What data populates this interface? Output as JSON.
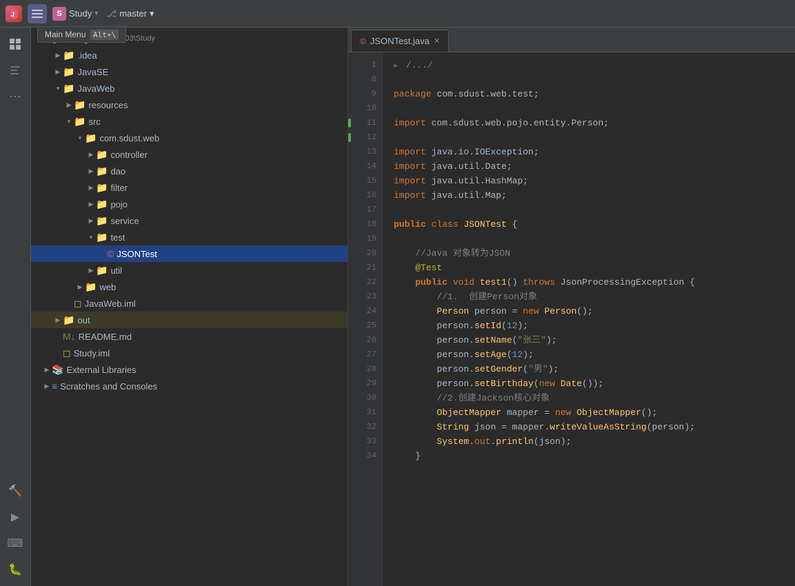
{
  "titlebar": {
    "app_icon": "J",
    "menu_icon": "☰",
    "project_name": "Study",
    "project_chevron": "▾",
    "branch_icon": "⎇",
    "branch_name": "master",
    "branch_chevron": "▾"
  },
  "tooltip": {
    "label": "Main Menu",
    "shortcut": "Alt+\\"
  },
  "iconbar": {
    "icons": [
      {
        "name": "folder-icon",
        "glyph": "📁"
      },
      {
        "name": "structure-icon",
        "glyph": "⊞"
      },
      {
        "name": "more-icon",
        "glyph": "⋯"
      }
    ],
    "bottom_icons": [
      {
        "name": "hammer-icon",
        "glyph": "🔨"
      },
      {
        "name": "run-icon",
        "glyph": "▶"
      },
      {
        "name": "terminal-icon",
        "glyph": "⌨"
      },
      {
        "name": "debug-icon",
        "glyph": "🐛"
      }
    ]
  },
  "filetree": {
    "items": [
      {
        "id": "study-root",
        "label": "Study",
        "path": "E:\\java2403\\Study",
        "indent": "indent1",
        "arrow": "▾",
        "expanded": true,
        "icon": "📁",
        "icon_class": "folder-yellow"
      },
      {
        "id": "idea",
        "label": ".idea",
        "indent": "indent2",
        "arrow": "▶",
        "expanded": false,
        "icon": "📁",
        "icon_class": "folder-blue"
      },
      {
        "id": "javase",
        "label": "JavaSE",
        "indent": "indent2",
        "arrow": "▶",
        "expanded": false,
        "icon": "📁",
        "icon_class": "folder-blue"
      },
      {
        "id": "javaweb",
        "label": "JavaWeb",
        "indent": "indent2",
        "arrow": "▾",
        "expanded": true,
        "icon": "📁",
        "icon_class": "folder-blue"
      },
      {
        "id": "resources",
        "label": "resources",
        "indent": "indent3",
        "arrow": "▶",
        "expanded": false,
        "icon": "📁",
        "icon_class": "folder-blue"
      },
      {
        "id": "src",
        "label": "src",
        "indent": "indent3",
        "arrow": "▾",
        "expanded": true,
        "icon": "📁",
        "icon_class": "folder-blue"
      },
      {
        "id": "com-sdust-web",
        "label": "com.sdust.web",
        "indent": "indent4",
        "arrow": "▾",
        "expanded": true,
        "icon": "📁",
        "icon_class": "folder-blue"
      },
      {
        "id": "controller",
        "label": "controller",
        "indent": "indent5",
        "arrow": "▶",
        "expanded": false,
        "icon": "📁",
        "icon_class": "folder-blue"
      },
      {
        "id": "dao",
        "label": "dao",
        "indent": "indent5",
        "arrow": "▶",
        "expanded": false,
        "icon": "📁",
        "icon_class": "folder-blue"
      },
      {
        "id": "filter",
        "label": "filter",
        "indent": "indent5",
        "arrow": "▶",
        "expanded": false,
        "icon": "📁",
        "icon_class": "folder-blue"
      },
      {
        "id": "pojo",
        "label": "pojo",
        "indent": "indent5",
        "arrow": "▶",
        "expanded": false,
        "icon": "📁",
        "icon_class": "folder-blue"
      },
      {
        "id": "service",
        "label": "service",
        "indent": "indent5",
        "arrow": "▶",
        "expanded": false,
        "icon": "📁",
        "icon_class": "folder-blue"
      },
      {
        "id": "test",
        "label": "test",
        "indent": "indent5",
        "arrow": "▾",
        "expanded": true,
        "icon": "📁",
        "icon_class": "folder-blue"
      },
      {
        "id": "jsontest",
        "label": "JSONTest",
        "indent": "indent6",
        "arrow": "",
        "expanded": false,
        "icon": "©",
        "icon_class": "file-java",
        "selected": true
      },
      {
        "id": "util",
        "label": "util",
        "indent": "indent5",
        "arrow": "▶",
        "expanded": false,
        "icon": "📁",
        "icon_class": "folder-blue"
      },
      {
        "id": "web",
        "label": "web",
        "indent": "indent4",
        "arrow": "▶",
        "expanded": false,
        "icon": "📁",
        "icon_class": "folder-blue"
      },
      {
        "id": "javaweb-iml",
        "label": "JavaWeb.iml",
        "indent": "indent3",
        "arrow": "",
        "expanded": false,
        "icon": "◻",
        "icon_class": "file-iml"
      },
      {
        "id": "out",
        "label": "out",
        "indent": "indent2",
        "arrow": "▶",
        "expanded": false,
        "icon": "📁",
        "icon_class": "folder-yellow",
        "highlighted": true
      },
      {
        "id": "readme",
        "label": "README.md",
        "indent": "indent2",
        "arrow": "",
        "expanded": false,
        "icon": "M↓",
        "icon_class": "file-md"
      },
      {
        "id": "study-iml",
        "label": "Study.iml",
        "indent": "indent2",
        "arrow": "",
        "expanded": false,
        "icon": "◻",
        "icon_class": "file-iml"
      },
      {
        "id": "ext-libs",
        "label": "External Libraries",
        "indent": "indent1",
        "arrow": "▶",
        "expanded": false,
        "icon": "📚",
        "icon_class": "folder-blue"
      },
      {
        "id": "scratches",
        "label": "Scratches and Consoles",
        "indent": "indent1",
        "arrow": "▶",
        "expanded": false,
        "icon": "≡",
        "icon_class": "folder-blue"
      }
    ]
  },
  "editor": {
    "tab_icon": "©",
    "tab_label": "JSONTest.java",
    "tab_close": "✕",
    "lines": [
      {
        "num": 1,
        "fold": true,
        "content_html": "<span class='fold-indicator'>▶</span> <span class='comment'>/.../ </span>"
      },
      {
        "num": 8,
        "content_html": ""
      },
      {
        "num": 9,
        "content_html": "<span class='kw'>package</span> <span class='pkg'>com.sdust.web.test;</span>"
      },
      {
        "num": 10,
        "content_html": ""
      },
      {
        "num": 11,
        "content_html": "<span class='import-kw'>import</span> <span class='pkg'>com.sdust.web.pojo.entity.Person;</span>"
      },
      {
        "num": 12,
        "content_html": ""
      },
      {
        "num": 13,
        "content_html": "<span class='import-kw'>import</span> <span class='pkg'>java.io.IOException;</span>"
      },
      {
        "num": 14,
        "content_html": "<span class='import-kw'>import</span> <span class='pkg'>java.util.Date;</span>"
      },
      {
        "num": 15,
        "content_html": "<span class='import-kw'>import</span> <span class='pkg'>java.util.HashMap;</span>"
      },
      {
        "num": 16,
        "content_html": "<span class='import-kw'>import</span> <span class='pkg'>java.util.Map;</span>"
      },
      {
        "num": 17,
        "content_html": ""
      },
      {
        "num": 18,
        "content_html": "<span class='kw2'>public</span> <span class='kw'>class</span> <span class='class-name'>JSONTest</span> <span class='type'>{</span>"
      },
      {
        "num": 19,
        "content_html": ""
      },
      {
        "num": 20,
        "content_html": "    <span class='comment'>//Java 对象转为JSON</span>"
      },
      {
        "num": 21,
        "content_html": "    <span class='annotation'>@Test</span>"
      },
      {
        "num": 22,
        "content_html": "    <span class='kw2'>public</span> <span class='kw'>void</span> <span class='method'>test1</span>() <span class='kw'>throws</span> <span class='exception-cls'>JsonProcessingException</span> {"
      },
      {
        "num": 23,
        "content_html": "        <span class='comment'>//1.  创建Person对象</span>"
      },
      {
        "num": 24,
        "content_html": "        <span class='class-name'>Person</span> <span class='var'>person</span> = <span class='kw'>new</span> <span class='class-name'>Person</span>();"
      },
      {
        "num": 25,
        "content_html": "        <span class='var'>person</span>.<span class='method'>setId</span>(<span class='num'>12</span>);"
      },
      {
        "num": 26,
        "content_html": "        <span class='var'>person</span>.<span class='method'>setName</span>(<span class='str'>\"张三\"</span>);"
      },
      {
        "num": 27,
        "content_html": "        <span class='var'>person</span>.<span class='method'>setAge</span>(<span class='num'>12</span>);"
      },
      {
        "num": 28,
        "content_html": "        <span class='var'>person</span>.<span class='method'>setGender</span>(<span class='str'>\"男\"</span>);"
      },
      {
        "num": 29,
        "content_html": "        <span class='var'>person</span>.<span class='method'>setBirthday</span>(<span class='kw'>new</span> <span class='class-name'>Date</span>());"
      },
      {
        "num": 30,
        "content_html": "        <span class='comment'>//2.创建Jackson核心对象</span>"
      },
      {
        "num": 31,
        "content_html": "        <span class='class-name'>ObjectMapper</span> <span class='var'>mapper</span> = <span class='kw'>new</span> <span class='class-name'>ObjectMapper</span>();"
      },
      {
        "num": 32,
        "content_html": "        <span class='class-name'>String</span> <span class='var'>json</span> = <span class='var'>mapper</span>.<span class='method'>writeValueAsString</span>(<span class='var'>person</span>);"
      },
      {
        "num": 33,
        "content_html": "        <span class='class-name'>System</span>.<span class='kw'>out</span>.<span class='method'>println</span>(<span class='var'>json</span>);"
      },
      {
        "num": 34,
        "content_html": "    }"
      }
    ]
  }
}
